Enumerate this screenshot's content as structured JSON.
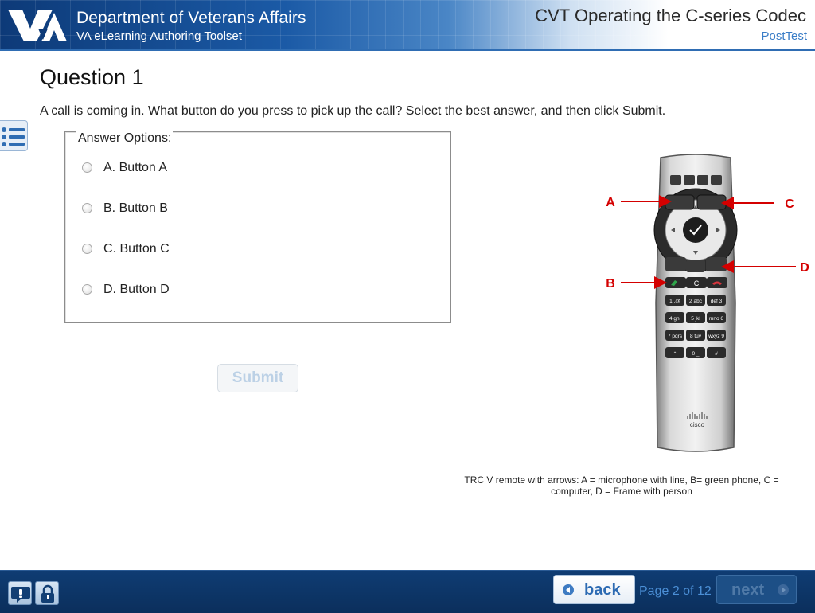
{
  "header": {
    "department": "Department of Veterans Affairs",
    "toolset": "VA eLearning Authoring Toolset",
    "course_title": "CVT Operating the C-series Codec",
    "section": "PostTest",
    "logo_icon": "va-logo"
  },
  "menu": {
    "icon": "list-icon"
  },
  "question": {
    "title": "Question 1",
    "text": "A call is coming in. What button do you press to pick up the call? Select the best answer, and then click Submit.",
    "answer_legend": "Answer Options:",
    "options": [
      {
        "label": "A. Button A",
        "selected": false
      },
      {
        "label": "B. Button B",
        "selected": false
      },
      {
        "label": "C. Button C",
        "selected": false
      },
      {
        "label": "D. Button D",
        "selected": false
      }
    ],
    "submit_label": "Submit",
    "submit_enabled": false
  },
  "figure": {
    "callouts": {
      "a": "A",
      "b": "B",
      "c": "C",
      "d": "D"
    },
    "keypad": [
      "1 .@",
      "2 abc",
      "def 3",
      "4 ghi",
      "5 jkl",
      "mno 6",
      "7 pqrs",
      "8 tuv",
      "wxyz 9",
      "*",
      "0 _",
      "#"
    ],
    "clear_key": "C",
    "brand": "cisco",
    "caption": "TRC V remote with arrows: A = microphone with line, B= green phone, C = computer, D = Frame with person"
  },
  "footer": {
    "back_label": "back",
    "next_label": "next",
    "page_indicator": "Page 2 of 12",
    "help_icon": "help-icon",
    "lock_icon": "lock-icon"
  },
  "colors": {
    "header_blue": "#0d3a78",
    "footer_blue": "#0b2f5c",
    "link_blue": "#3a7dc7",
    "callout_red": "#d40000"
  }
}
